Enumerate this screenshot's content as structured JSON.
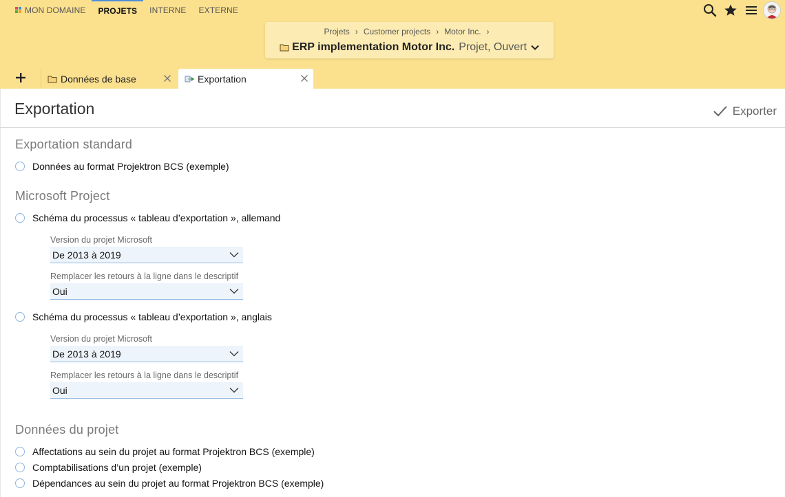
{
  "topnav": {
    "items": [
      {
        "label": "MON DOMAINE"
      },
      {
        "label": "PROJETS"
      },
      {
        "label": "INTERNE"
      },
      {
        "label": "EXTERNE"
      }
    ]
  },
  "breadcrumb": {
    "items": [
      "Projets",
      "Customer projects",
      "Motor Inc."
    ],
    "separator": "›"
  },
  "project": {
    "name": "ERP implementation Motor Inc.",
    "status": "Projet, Ouvert"
  },
  "tabs": [
    {
      "label": "Données de base"
    },
    {
      "label": "Exportation"
    }
  ],
  "page": {
    "title": "Exportation",
    "export_label": "Exporter"
  },
  "sections": {
    "standard": {
      "title": "Exportation standard",
      "option": "Données au format Projektron BCS (exemple)"
    },
    "msproject": {
      "title": "Microsoft Project",
      "option_de": "Schéma du processus « tableau d’exportation », allemand",
      "option_en": "Schéma du processus « tableau d’exportation », anglais",
      "version_label": "Version du projet Microsoft",
      "version_value": "De 2013 à 2019",
      "replace_label": "Remplacer les retours à la ligne dans le descriptif",
      "replace_value": "Oui"
    },
    "projectdata": {
      "title": "Données du projet",
      "options": [
        "Affectations au sein du projet au format Projektron BCS (exemple)",
        "Comptabilisations d’un projet (exemple)",
        "Dépendances au sein du projet au format Projektron BCS (exemple)"
      ]
    }
  },
  "colors": {
    "header_bg": "#fbe08e",
    "crumb_box_bg": "#fcebb2",
    "active_nav_accent": "#4a8fd8",
    "select_bg": "#eef4fb",
    "radio_border": "#8fb6e0"
  },
  "icons": {
    "search": "search-icon",
    "favorites": "star-icon",
    "menu": "hamburger-menu-icon",
    "add_tab": "plus-icon",
    "folder": "folder-icon",
    "export_tab": "export-arrow-icon",
    "close": "close-icon",
    "check": "check-icon",
    "chevron": "chevron-down-icon"
  }
}
